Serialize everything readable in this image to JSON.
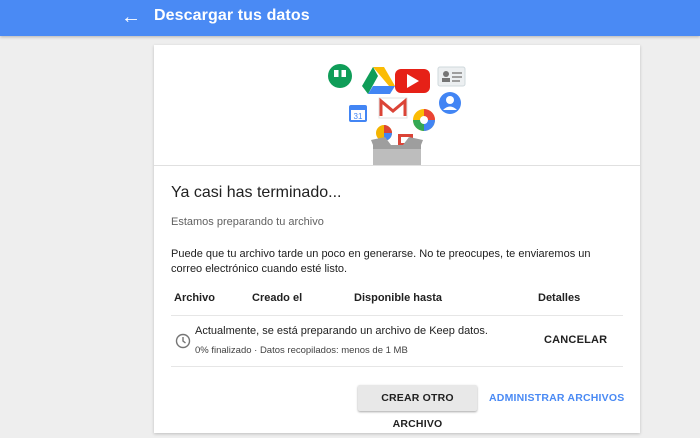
{
  "header": {
    "back_icon": "arrow-back-icon",
    "title": "Descargar tus datos",
    "color": "#4a8af4"
  },
  "hero": {
    "icons": [
      "hangouts-icon",
      "drive-icon",
      "youtube-icon",
      "contacts-icon",
      "calendar-icon",
      "gmail-icon",
      "photos-icon",
      "profile-icon",
      "sheets-icon",
      "slides-icon",
      "box-icon"
    ],
    "calendar_day": "31"
  },
  "main": {
    "heading": "Ya casi has terminado...",
    "subheading": "Estamos preparando tu archivo",
    "notice": "Puede que tu archivo tarde un poco en generarse. No te preocupes, te enviaremos un correo electrónico cuando esté listo."
  },
  "table": {
    "headers": {
      "archivo": "Archivo",
      "creado": "Creado el",
      "disponible": "Disponible hasta",
      "detalles": "Detalles"
    },
    "row": {
      "icon": "clock-icon",
      "status": "Actualmente, se está preparando un archivo de Keep datos.",
      "progress": "0% finalizado · Datos recopilados: menos de 1 MB",
      "action": "CANCELAR"
    }
  },
  "actions": {
    "create": "CREAR OTRO ARCHIVO",
    "manage": "ADMINISTRAR ARCHIVOS",
    "accent": "#4a8af4"
  }
}
